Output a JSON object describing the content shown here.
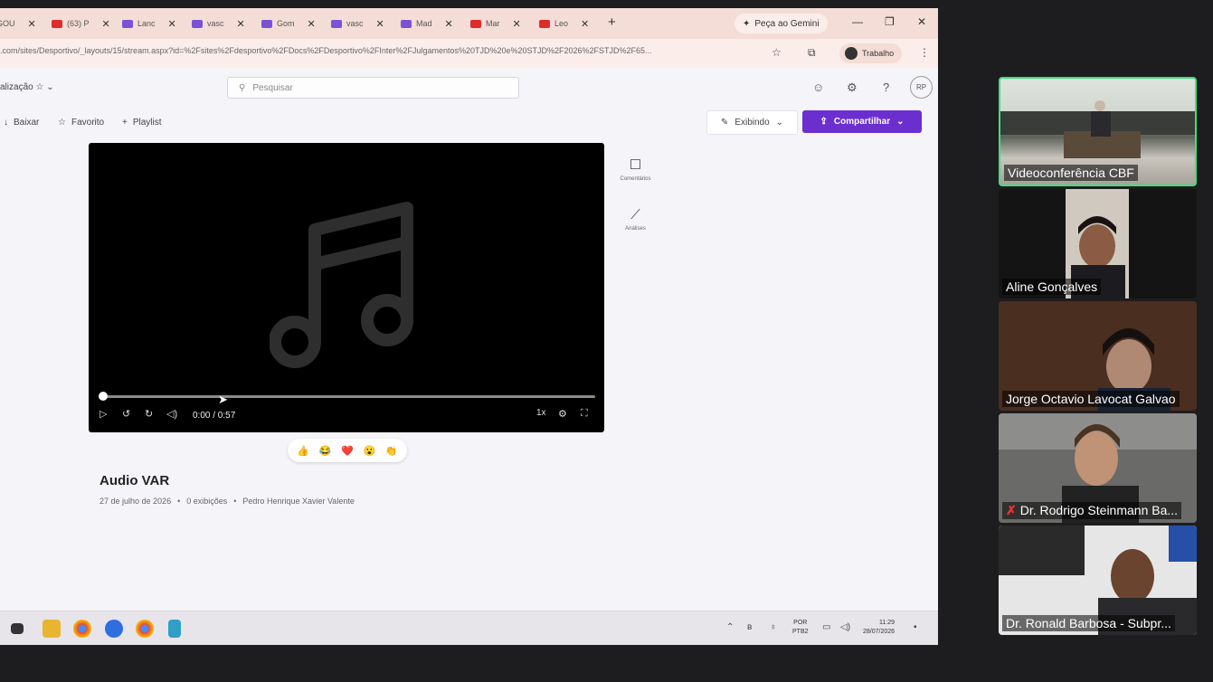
{
  "browser": {
    "tabs": [
      {
        "label": "GOU",
        "fav": "wh"
      },
      {
        "label": "(63) P",
        "fav": "yt"
      },
      {
        "label": "Lanc",
        "fav": "st"
      },
      {
        "label": "vasc",
        "fav": "st"
      },
      {
        "label": "Gom",
        "fav": "st"
      },
      {
        "label": "vasc",
        "fav": "st"
      },
      {
        "label": "Mad",
        "fav": "st"
      },
      {
        "label": "Mar",
        "fav": "yt"
      },
      {
        "label": "Leo",
        "fav": "yt"
      }
    ],
    "new_tab": "+",
    "gemini_label": "Peça ao Gemini",
    "url": ".com/sites/Desportivo/_layouts/15/stream.aspx?id=%2Fsites%2Fdesportivo%2FDocs%2FDesportivo%2FInter%2FJulgamentos%20TJD%20e%20STJD%2F2026%2FSTJD%2F65...",
    "profile_label": "Trabalho"
  },
  "app": {
    "breadcrumb": "alização ☆ ⌄",
    "search_placeholder": "Pesquisar",
    "avatar_initials": "RP",
    "toolbar": {
      "download": "Baixar",
      "favorite": "Favorito",
      "playlist": "Playlist",
      "exibindo": "Exibindo",
      "compartilhar": "Compartilhar"
    }
  },
  "player": {
    "progress": 0.0,
    "time": "0:00 / 0:57",
    "speed": "1x"
  },
  "side_actions": {
    "comments": "Comentários",
    "analytics": "Análises"
  },
  "reactions": [
    "👍",
    "😂",
    "❤️",
    "😮",
    "👏"
  ],
  "video": {
    "title": "Audio VAR",
    "date": "27 de julho de 2026",
    "views": "0 exibições",
    "author": "Pedro Henrique Xavier Valente"
  },
  "taskbar": {
    "lang": "POR",
    "layout": "PTB2",
    "time": "11:29",
    "date": "28/07/2026"
  },
  "participants": [
    {
      "name": "Videoconferência CBF",
      "active": true
    },
    {
      "name": "Aline Gonçalves",
      "active": false
    },
    {
      "name": "Jorge Octavio Lavocat Galvao",
      "active": false
    },
    {
      "name": "Dr. Rodrigo Steinmann Ba...",
      "active": false,
      "muted": true
    },
    {
      "name": "Dr. Ronald Barbosa - Subpr...",
      "active": false
    }
  ]
}
